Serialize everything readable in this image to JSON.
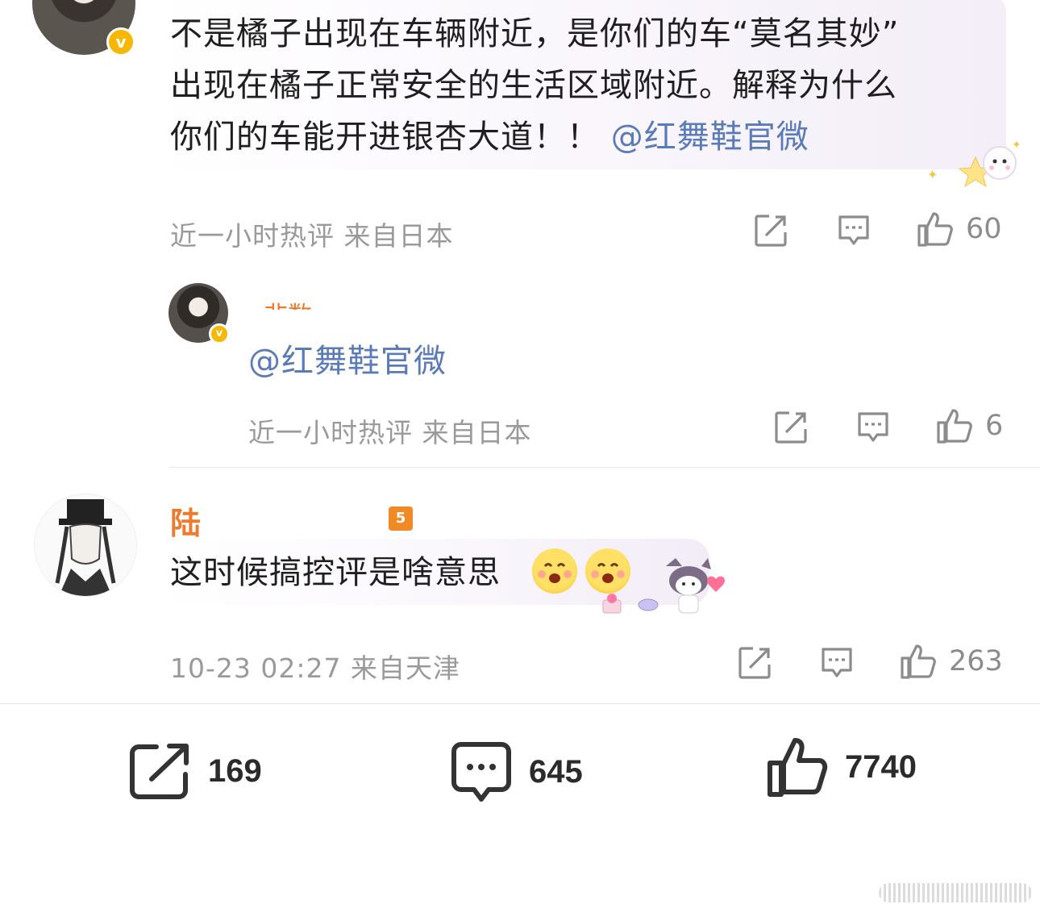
{
  "comment1": {
    "text_lines": [
      "不是橘子出现在车辆附近，是你们的车“莫名其妙”",
      "出现在橘子正常安全的生活区域附近。解释为什么",
      "你们的车能开进银杏大道！！"
    ],
    "mention": "@红舞鞋官微",
    "meta": "近一小时热评  来自日本",
    "likes": "60",
    "badge": "v"
  },
  "reply1": {
    "username": "· 非数 ·",
    "text": "@红舞鞋官微",
    "meta": "近一小时热评  来自日本",
    "likes": "6",
    "badge": "v"
  },
  "comment2": {
    "username": "陆",
    "level": "5",
    "text": "这时候搞控评是啥意思",
    "emoji": [
      "😊",
      "😊"
    ],
    "meta": "10-23 02:27  来自天津",
    "likes": "263"
  },
  "bottom_bar": {
    "repost_count": "169",
    "comment_count": "645",
    "like_count": "7740"
  },
  "colors": {
    "mention": "#5b7bb8",
    "username_orange": "#f07a2c",
    "badge_yellow": "#f6b800",
    "meta_gray": "#9a9a9a"
  },
  "icons": [
    "share-icon",
    "comment-icon",
    "like-icon",
    "repost-icon",
    "verified-badge-icon",
    "sticker"
  ]
}
